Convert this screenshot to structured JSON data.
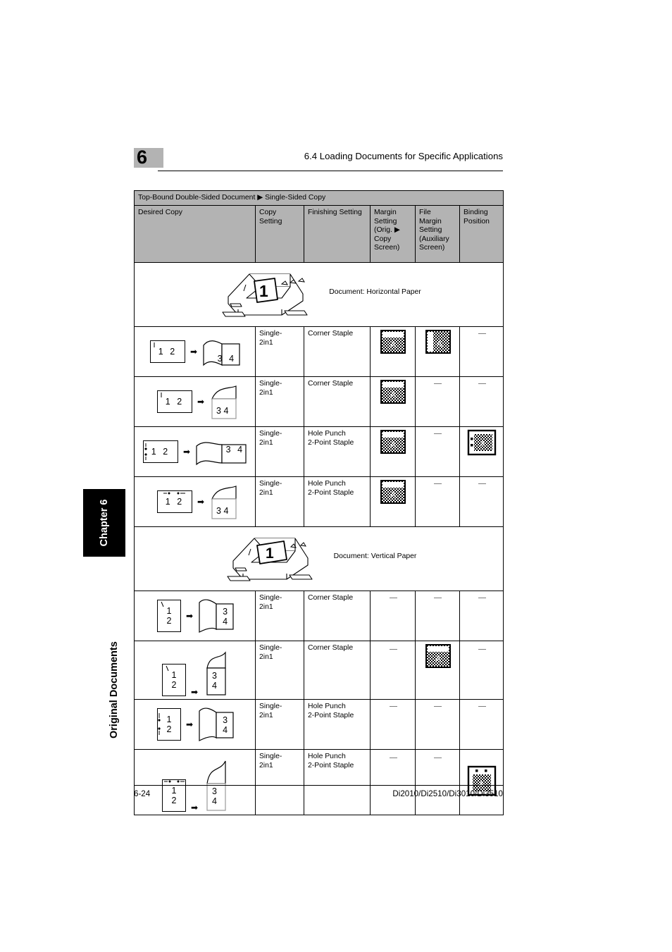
{
  "header": {
    "chapter_number": "6",
    "title": "6.4 Loading Documents for Specific Applications"
  },
  "side_tab": {
    "chapter_label": "Chapter 6",
    "section_label": "Original Documents"
  },
  "footer": {
    "page_number": "6-24",
    "model_list": "Di2010/Di2510/Di3010/Di3510"
  },
  "table": {
    "caption": "Top-Bound Double-Sided Document ▶ Single-Sided Copy",
    "columns": [
      "Desired Copy",
      "Copy Setting",
      "Finishing Setting",
      "Margin Setting (Orig. ▶ Copy Screen)",
      "File Margin Setting (Auxiliary Screen)",
      "Binding Position"
    ],
    "column_lines": {
      "copy_setting": [
        "Copy",
        "Setting"
      ],
      "finishing_setting": [
        "Finishing Setting"
      ],
      "margin_setting": [
        "Margin",
        "Setting",
        "(Orig. ▶",
        "Copy",
        "Screen)"
      ],
      "file_margin_setting": [
        "File",
        "Margin",
        "Setting",
        "(Auxiliary",
        "Screen)"
      ],
      "binding_position": [
        "Binding",
        "Position"
      ]
    },
    "illustration_rows": [
      {
        "caption": "Document: Horizontal Paper",
        "sheet_number": "1"
      },
      {
        "caption": "Document: Vertical Paper",
        "sheet_number": "1"
      }
    ],
    "rows": [
      {
        "orientation": "horizontal",
        "source_pages": "1 2",
        "output_pages": "3 4",
        "copy_setting": "Single-2in1",
        "finishing_setting": "Corner Staple",
        "margin_setting": "icon-margin-top",
        "file_margin_setting": "icon-margin-left",
        "binding_position": "—"
      },
      {
        "orientation": "horizontal",
        "source_pages": "1 2",
        "output_pages": "3 4",
        "copy_setting": "Single-2in1",
        "finishing_setting": "Corner Staple",
        "margin_setting": "icon-margin-top",
        "file_margin_setting": "—",
        "binding_position": "—"
      },
      {
        "orientation": "horizontal",
        "source_pages": "1 2",
        "output_pages": "3 4",
        "copy_setting": "Single-2in1",
        "finishing_setting": "Hole Punch 2-Point Staple",
        "margin_setting": "icon-margin-top",
        "file_margin_setting": "—",
        "binding_position": "icon-punch-left"
      },
      {
        "orientation": "horizontal",
        "source_pages": "1 2",
        "output_pages": "3 4",
        "copy_setting": "Single-2in1",
        "finishing_setting": "Hole Punch 2-Point Staple",
        "margin_setting": "icon-margin-top",
        "file_margin_setting": "—",
        "binding_position": "—"
      },
      {
        "orientation": "vertical",
        "source_pages": [
          "1",
          "2"
        ],
        "output_pages": [
          "3",
          "4"
        ],
        "copy_setting": "Single-2in1",
        "finishing_setting": "Corner Staple",
        "margin_setting": "—",
        "file_margin_setting": "—",
        "binding_position": "—"
      },
      {
        "orientation": "vertical",
        "source_pages": [
          "1",
          "2"
        ],
        "output_pages": [
          "3",
          "4"
        ],
        "copy_setting": "Single-2in1",
        "finishing_setting": "Corner Staple",
        "margin_setting": "—",
        "file_margin_setting": "icon-margin-top",
        "binding_position": "—"
      },
      {
        "orientation": "vertical",
        "source_pages": [
          "1",
          "2"
        ],
        "output_pages": [
          "3",
          "4"
        ],
        "copy_setting": "Single-2in1",
        "finishing_setting": "Hole Punch 2-Point Staple",
        "margin_setting": "—",
        "file_margin_setting": "—",
        "binding_position": "—"
      },
      {
        "orientation": "vertical",
        "source_pages": [
          "1",
          "2"
        ],
        "output_pages": [
          "3",
          "4"
        ],
        "copy_setting": "Single-2in1",
        "finishing_setting": "Hole Punch 2-Point Staple",
        "margin_setting": "—",
        "file_margin_setting": "—",
        "binding_position": "icon-punch-top"
      }
    ],
    "copy_setting_lines": [
      "Single-",
      "2in1"
    ],
    "finishing_corner": "Corner Staple",
    "finishing_punch_lines": [
      "Hole Punch",
      "2-Point Staple"
    ],
    "dash_symbol": "—"
  },
  "colors": {
    "header_gray": "#b3b3b3",
    "tab_black": "#000000",
    "page_white": "#ffffff"
  }
}
